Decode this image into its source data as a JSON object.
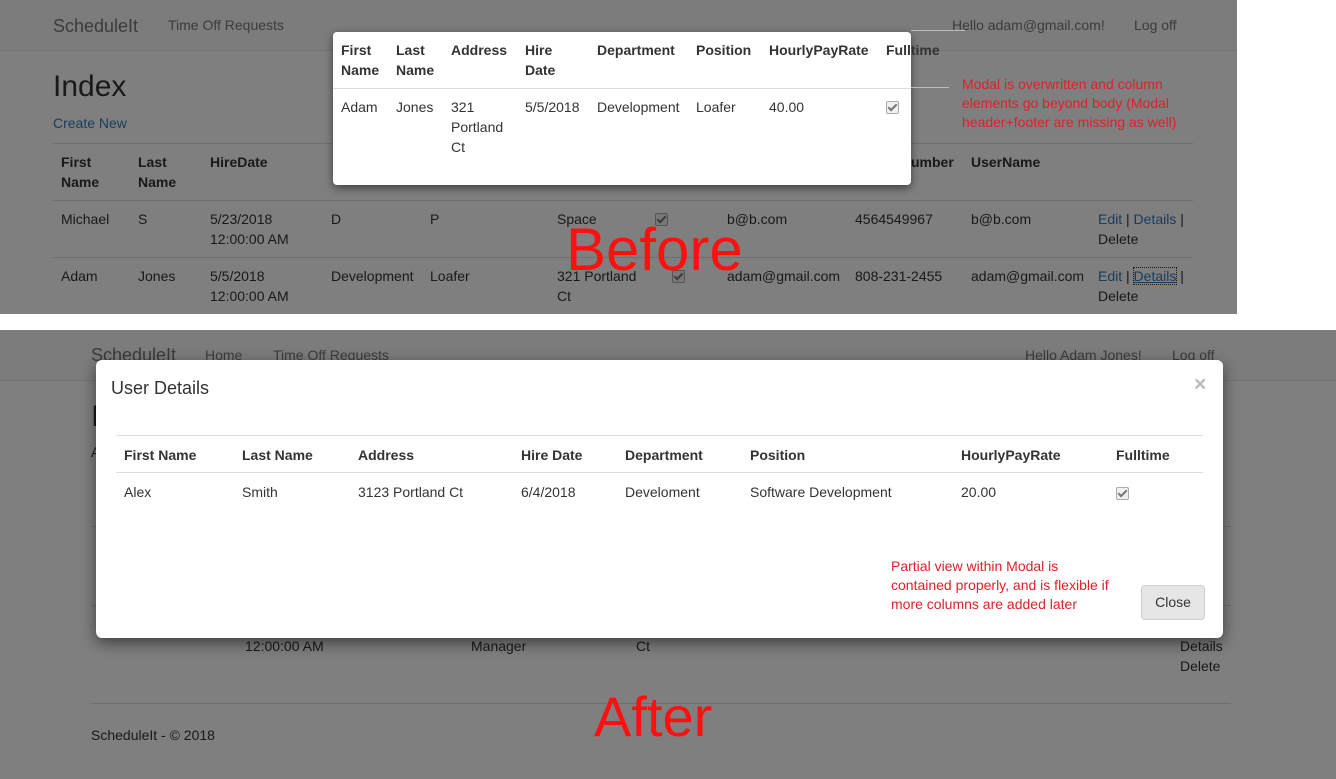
{
  "before": {
    "brand": "ScheduleIt",
    "nav_time_off": "Time Off Requests",
    "hello": "Hello adam@gmail.com!",
    "logoff": "Log off",
    "page_title": "Index",
    "create_new": "Create New",
    "table_headers": [
      "First Name",
      "Last Name",
      "HireDate",
      "",
      "",
      "",
      "",
      "",
      "umber",
      "UserName"
    ],
    "rows": [
      {
        "first": "Michael",
        "last": "S",
        "hire": "5/23/2018 12:00:00 AM",
        "dept": "D",
        "pos": "P",
        "addr": "Space",
        "email": "b@b.com",
        "phone": "4564549967",
        "user": "b@b.com"
      },
      {
        "first": "Adam",
        "last": "Jones",
        "hire": "5/5/2018 12:00:00 AM",
        "dept": "Development",
        "pos": "Loafer",
        "addr": "321 Portland Ct",
        "email": "adam@gmail.com",
        "phone": "808-231-2455",
        "user": "adam@gmail.com"
      }
    ],
    "actions": {
      "edit": "Edit",
      "details": "Details",
      "delete": "Delete",
      "sep": "|"
    },
    "modal": {
      "headers": [
        "First Name",
        "Last Name",
        "Address",
        "Hire Date",
        "Department",
        "Position",
        "HourlyPayRate",
        "Fulltime"
      ],
      "row": {
        "first": "Adam",
        "last": "Jones",
        "address": "321 Portland Ct",
        "hire": "5/5/2018",
        "dept": "Development",
        "pos": "Loafer",
        "rate": "40.00",
        "fulltime": true
      }
    },
    "annotation": "Modal is overwritten and column elements go beyond body (Modal header+footer are missing as well)",
    "label": "Before"
  },
  "after": {
    "brand": "ScheduleIt",
    "nav_home": "Home",
    "nav_time_off": "Time Off Requests",
    "hello": "Hello Adam Jones!",
    "logoff": "Log off",
    "bg_title": "I",
    "bg_create": "A",
    "bg_time": "12:00:00 AM",
    "bg_manager": "Manager",
    "bg_ct": "Ct",
    "bg_details": "Details",
    "bg_delete": "Delete",
    "footer": "ScheduleIt - © 2018",
    "modal": {
      "title": "User Details",
      "close_x": "×",
      "headers": [
        "First Name",
        "Last Name",
        "Address",
        "Hire Date",
        "Department",
        "Position",
        "HourlyPayRate",
        "Fulltime"
      ],
      "row": {
        "first": "Alex",
        "last": "Smith",
        "address": "3123 Portland Ct",
        "hire": "6/4/2018",
        "dept": "Develoment",
        "pos": "Software Development",
        "rate": "20.00",
        "fulltime": true
      },
      "close_button": "Close"
    },
    "annotation": "Partial view within Modal is contained properly, and is flexible if more columns are added later",
    "label": "After"
  },
  "colors": {
    "annotation_red": "#e0202a",
    "label_red": "#ff1010",
    "link": "#337ab7"
  }
}
